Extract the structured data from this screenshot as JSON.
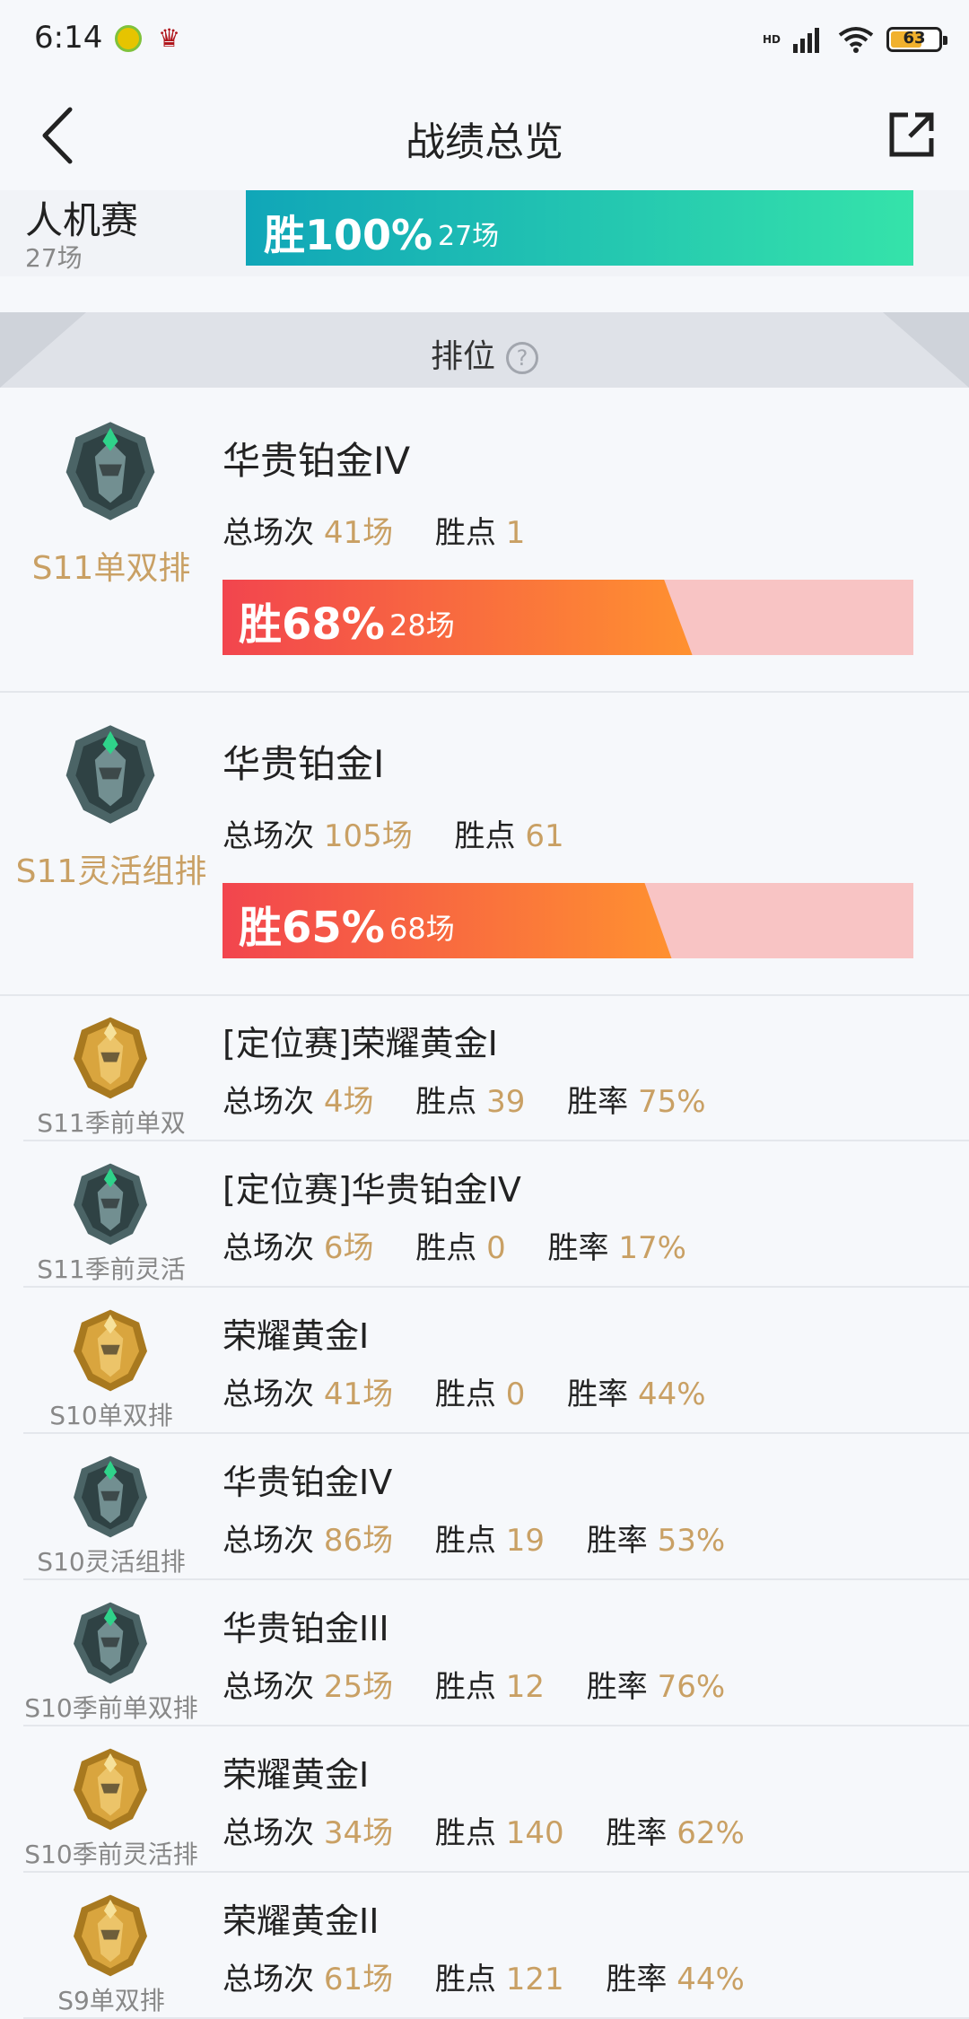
{
  "status_bar": {
    "time": "6:14",
    "hd": "HD",
    "battery": "63"
  },
  "header": {
    "title": "战绩总览",
    "back_icon": "chevron-left-icon",
    "share_icon": "share-external-icon"
  },
  "pve": {
    "name": "人机赛",
    "count": "27场",
    "win_pct": "胜100%",
    "win_games": "27场",
    "win_fraction": 1.0
  },
  "rank_section": {
    "title": "排位",
    "help": "?"
  },
  "big_cards": [
    {
      "queue": "S11单双排",
      "rank": "华贵铂金IV",
      "total_label": "总场次",
      "total": "41场",
      "points_label": "胜点",
      "points": "1",
      "win_pct": "胜68%",
      "win_games": "28场",
      "win_fraction": 0.68,
      "badge": "platinum"
    },
    {
      "queue": "S11灵活组排",
      "rank": "华贵铂金I",
      "total_label": "总场次",
      "total": "105场",
      "points_label": "胜点",
      "points": "61",
      "win_pct": "胜65%",
      "win_games": "68场",
      "win_fraction": 0.65,
      "badge": "platinum"
    }
  ],
  "rows": [
    {
      "queue": "S11季前单双",
      "rank": "[定位赛]荣耀黄金I",
      "total_label": "总场次",
      "total": "4场",
      "points_label": "胜点",
      "points": "39",
      "rate_label": "胜率",
      "rate": "75%",
      "badge": "gold"
    },
    {
      "queue": "S11季前灵活",
      "rank": "[定位赛]华贵铂金IV",
      "total_label": "总场次",
      "total": "6场",
      "points_label": "胜点",
      "points": "0",
      "rate_label": "胜率",
      "rate": "17%",
      "badge": "platinum"
    },
    {
      "queue": "S10单双排",
      "rank": "荣耀黄金I",
      "total_label": "总场次",
      "total": "41场",
      "points_label": "胜点",
      "points": "0",
      "rate_label": "胜率",
      "rate": "44%",
      "badge": "gold"
    },
    {
      "queue": "S10灵活组排",
      "rank": "华贵铂金IV",
      "total_label": "总场次",
      "total": "86场",
      "points_label": "胜点",
      "points": "19",
      "rate_label": "胜率",
      "rate": "53%",
      "badge": "platinum"
    },
    {
      "queue": "S10季前单双排",
      "rank": "华贵铂金III",
      "total_label": "总场次",
      "total": "25场",
      "points_label": "胜点",
      "points": "12",
      "rate_label": "胜率",
      "rate": "76%",
      "badge": "platinum"
    },
    {
      "queue": "S10季前灵活排",
      "rank": "荣耀黄金I",
      "total_label": "总场次",
      "total": "34场",
      "points_label": "胜点",
      "points": "140",
      "rate_label": "胜率",
      "rate": "62%",
      "badge": "gold"
    },
    {
      "queue": "S9单双排",
      "rank": "荣耀黄金II",
      "total_label": "总场次",
      "total": "61场",
      "points_label": "胜点",
      "points": "121",
      "rate_label": "胜率",
      "rate": "44%",
      "badge": "gold"
    }
  ]
}
